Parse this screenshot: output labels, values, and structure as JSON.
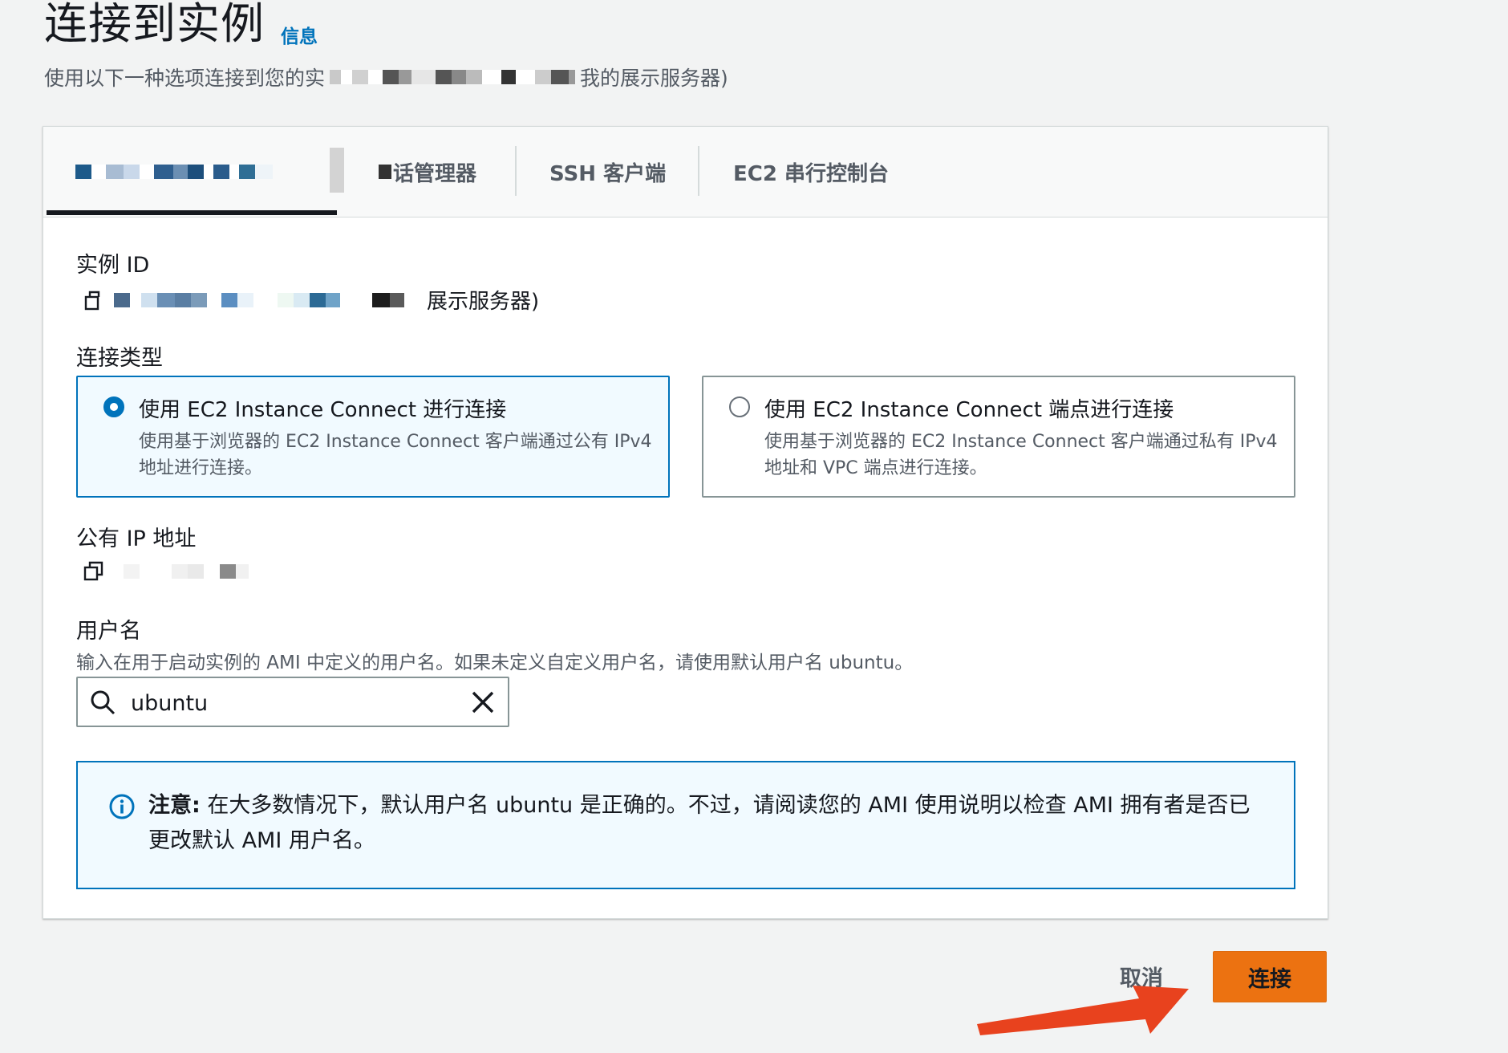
{
  "header": {
    "title": "连接到实例",
    "info_link": "信息",
    "subtitle_prefix": "使用以下一种选项连接到您的实",
    "subtitle_suffix": "我的展示服务器)"
  },
  "tabs": [
    {
      "label": "",
      "active": true
    },
    {
      "label": "话管理器",
      "active": false
    },
    {
      "label": "SSH 客户端",
      "active": false
    },
    {
      "label": "EC2 串行控制台",
      "active": false
    }
  ],
  "instance_id": {
    "label": "实例 ID",
    "value_suffix": "展示服务器)"
  },
  "connection_type": {
    "label": "连接类型",
    "options": [
      {
        "title": "使用 EC2 Instance Connect 进行连接",
        "description": "使用基于浏览器的 EC2 Instance Connect 客户端通过公有 IPv4 地址进行连接。",
        "selected": true
      },
      {
        "title": "使用 EC2 Instance Connect 端点进行连接",
        "description": "使用基于浏览器的 EC2 Instance Connect 客户端通过私有 IPv4 地址和 VPC 端点进行连接。",
        "selected": false
      }
    ]
  },
  "public_ip": {
    "label": "公有 IP 地址"
  },
  "username": {
    "label": "用户名",
    "description": "输入在用于启动实例的 AMI 中定义的用户名。如果未定义自定义用户名，请使用默认用户名 ubuntu。",
    "value": "ubuntu"
  },
  "alert": {
    "strong": "注意:",
    "text": "在大多数情况下，默认用户名 ubuntu 是正确的。不过，请阅读您的 AMI 使用说明以检查 AMI 拥有者是否已更改默认 AMI 用户名。"
  },
  "footer": {
    "cancel_label": "取消",
    "connect_label": "连接"
  },
  "colors": {
    "primary_button": "#ec7211",
    "selected_border": "#0073bb",
    "annotation_arrow": "#e8421e"
  },
  "icons": {
    "copy": "copy-icon",
    "search": "search-icon",
    "clear": "close-icon",
    "info": "info-icon",
    "arrow": "arrow-annotation"
  }
}
